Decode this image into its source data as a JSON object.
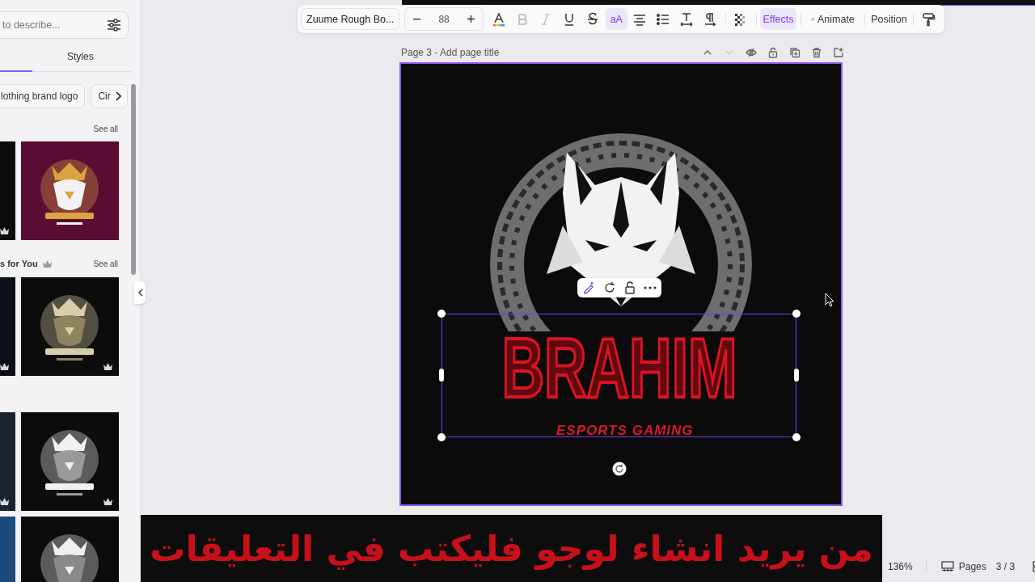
{
  "left_panel": {
    "search": {
      "placeholder": "to describe..."
    },
    "tabs": [
      {
        "label": "Styles",
        "selected": false
      }
    ],
    "chips": [
      {
        "label": "lothing brand logo"
      },
      {
        "label": "Cir"
      }
    ],
    "sections": [
      {
        "see_all": "See all",
        "thumbnails": [
          {
            "kind": "picture",
            "premium": true
          },
          {
            "kind": "picture",
            "premium": false
          }
        ]
      },
      {
        "title": "s for You",
        "premium": true,
        "see_all": "See all",
        "thumbnails": [
          {
            "kind": "picture",
            "premium": true
          },
          {
            "kind": "picture",
            "premium": true
          }
        ]
      },
      {
        "thumbnails": [
          {
            "kind": "picture",
            "premium": true
          },
          {
            "kind": "picture",
            "premium": true
          }
        ]
      },
      {
        "thumbnails": [
          {
            "kind": "picture",
            "premium": false
          },
          {
            "kind": "picture",
            "premium": false
          }
        ]
      }
    ]
  },
  "toolbar": {
    "font": "Zuume Rough Bo...",
    "size": "88",
    "tools": [
      {
        "kind": "text-color",
        "selected": false
      },
      {
        "kind": "bold",
        "disabled": true,
        "selected": false
      },
      {
        "kind": "italic",
        "disabled": true,
        "selected": false
      },
      {
        "kind": "underline",
        "disabled": false,
        "selected": false
      },
      {
        "kind": "strikethrough",
        "disabled": false,
        "selected": false
      },
      {
        "kind": "case",
        "label": "aA",
        "selected": true
      },
      {
        "kind": "align",
        "selected": false
      },
      {
        "kind": "list",
        "selected": false
      },
      {
        "kind": "letter-spacing",
        "selected": false
      },
      {
        "kind": "paragraph",
        "selected": false
      },
      {
        "kind": "transparency",
        "selected": false
      },
      {
        "kind": "effects",
        "label": "Effects",
        "selected": true
      },
      {
        "kind": "animate",
        "label": "Animate",
        "selected": false
      },
      {
        "kind": "position",
        "label": "Position",
        "selected": false
      },
      {
        "kind": "paint-format",
        "selected": false
      }
    ]
  },
  "page": {
    "title": "Page 3 - Add page title",
    "actions": [
      {
        "kind": "up",
        "disabled": false
      },
      {
        "kind": "down",
        "disabled": true
      },
      {
        "kind": "hide",
        "disabled": false
      },
      {
        "kind": "lock",
        "disabled": false
      },
      {
        "kind": "duplicate",
        "disabled": false
      },
      {
        "kind": "delete",
        "disabled": false
      },
      {
        "kind": "add",
        "disabled": false
      }
    ],
    "design": {
      "title": "BRAHIM",
      "subtitle": "ESPORTS GAMING",
      "selected": true
    }
  },
  "caption": "من يريد انشاء لوجو فليكتب في التعليقات",
  "status_bar": {
    "zoom": "136%",
    "pages_label": "Pages",
    "page_count": "3 / 3"
  }
}
